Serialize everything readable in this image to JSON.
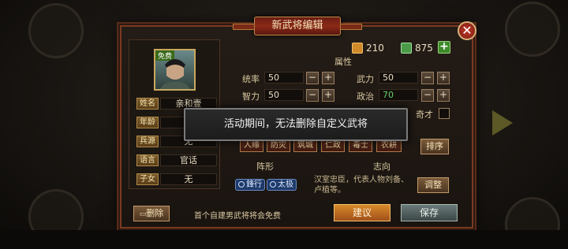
{
  "title": "新武将编辑",
  "currency": {
    "gold": "210",
    "jade": "875"
  },
  "portrait": {
    "tag": "免费"
  },
  "profile": [
    {
      "label": "姓名",
      "value": "亲和壹"
    },
    {
      "label": "年龄",
      "value": ""
    },
    {
      "label": "兵源",
      "value": "无"
    },
    {
      "label": "语言",
      "value": "官话"
    },
    {
      "label": "子女",
      "value": "无"
    }
  ],
  "attributes_title": "属性",
  "attributes": [
    {
      "label": "统率",
      "value": "50"
    },
    {
      "label": "武力",
      "value": "50"
    },
    {
      "label": "智力",
      "value": "50"
    },
    {
      "label": "政治",
      "value": "70"
    }
  ],
  "talent_label": "奇才",
  "skills": [
    "人缘",
    "防灾",
    "筑城",
    "仁政",
    "毒士",
    "农耕"
  ],
  "sort_button": "排序",
  "formation_title": "阵形",
  "formations": [
    "鋒行",
    "太极"
  ],
  "ambition_title": "志向",
  "ambition_desc": "汉室忠臣，代表人物刘备、卢植等。",
  "adjust_button": "调整",
  "delete_button": "删除",
  "free_note": "首个自建男武将将会免费",
  "suggest_button": "建议",
  "save_button": "保存",
  "toast": "活动期间，无法删除自定义武将"
}
